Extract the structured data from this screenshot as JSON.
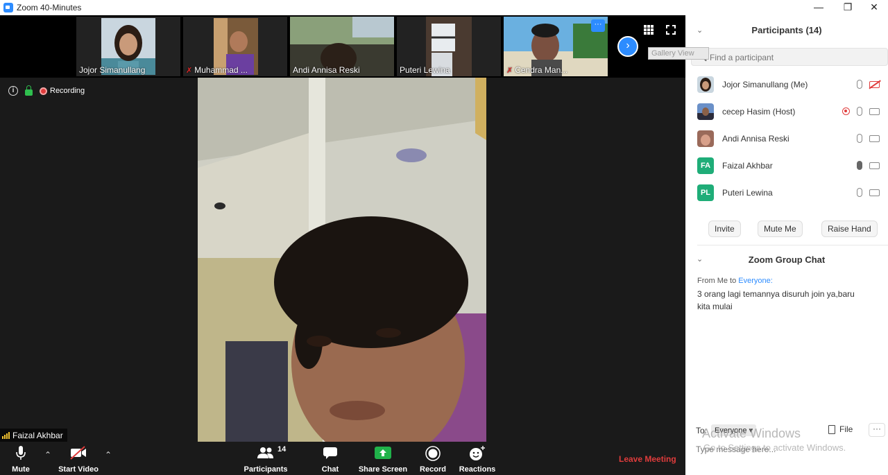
{
  "window": {
    "title": "Zoom 40-Minutes",
    "minimize_icon": "minimize-icon",
    "restore_icon": "restore-icon",
    "close_icon": "close-icon"
  },
  "gallery_strip": {
    "thumbnails": [
      {
        "name": "Jojor Simanullang",
        "muted": false
      },
      {
        "name": "Muhammad ...",
        "muted": true
      },
      {
        "name": "Andi Annisa Reski",
        "muted": false
      },
      {
        "name": "Puteri Lewina",
        "muted": false
      },
      {
        "name": "Cendra Man...",
        "muted": true
      }
    ],
    "more_glyph": "···",
    "next_glyph": "›",
    "tooltip": "Gallery View"
  },
  "status": {
    "recording_label": "Recording"
  },
  "active_speaker": {
    "name": "Faizal Akhbar"
  },
  "toolbar": {
    "mute_label": "Mute",
    "start_video_label": "Start Video",
    "participants_label": "Participants",
    "participants_count": "14",
    "chat_label": "Chat",
    "share_screen_label": "Share Screen",
    "record_label": "Record",
    "reactions_label": "Reactions",
    "leave_label": "Leave Meeting"
  },
  "participants_panel": {
    "title": "Participants (14)",
    "search_placeholder": "Find a participant",
    "participants": [
      {
        "name": "Jojor Simanullang (Me)",
        "initials": "",
        "avatar_color": "#7a6a55",
        "video_off": true
      },
      {
        "name": "cecep Hasim (Host)",
        "initials": "",
        "avatar_color": "#3f5f8f",
        "video_off": false
      },
      {
        "name": "Andi Annisa Reski",
        "initials": "",
        "avatar_color": "#9a6a5a",
        "video_off": false
      },
      {
        "name": "Faizal Akhbar",
        "initials": "FA",
        "avatar_color": "#1fad78",
        "video_off": false
      },
      {
        "name": "Puteri Lewina",
        "initials": "PL",
        "avatar_color": "#1fad78",
        "video_off": false
      }
    ],
    "invite_label": "Invite",
    "mute_me_label": "Mute Me",
    "raise_hand_label": "Raise Hand"
  },
  "chat_panel": {
    "title": "Zoom Group Chat",
    "from_prefix": "From Me to",
    "to_target": "Everyone:",
    "message": "3 orang lagi temannya disuruh join ya,baru kita mulai",
    "to_label": "To:",
    "everyone_label": "Everyone",
    "file_label": "File",
    "more_glyph": "···",
    "input_placeholder": "Type message here..."
  },
  "watermark": {
    "line1": "Activate Windows",
    "line2": "Go to Settings to activate Windows."
  },
  "colors": {
    "zoom_blue": "#2d8cff",
    "leave_red": "#e03c3c",
    "share_green": "#20b24a",
    "avatar_green": "#1fad78"
  }
}
